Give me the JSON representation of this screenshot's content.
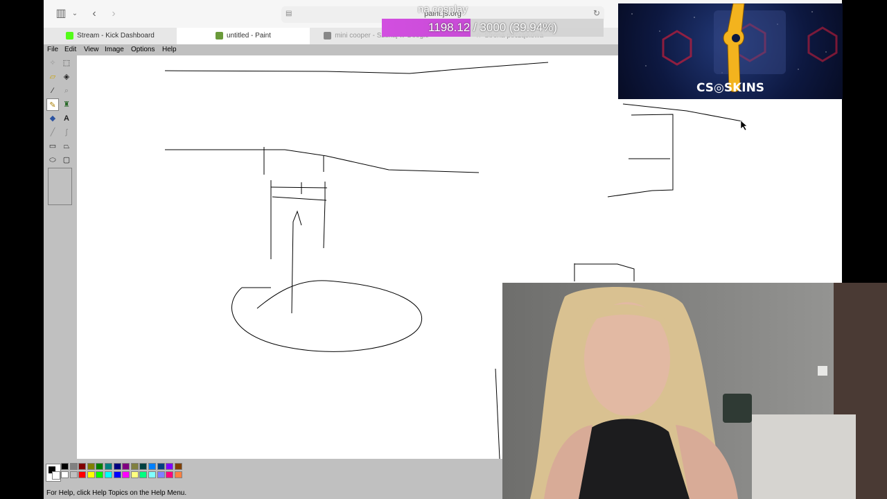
{
  "browser": {
    "url": "paint.js.org",
    "tabs": [
      {
        "label": "Stream - Kick Dashboard",
        "favicon_color": "#53fc18"
      },
      {
        "label": "untitled - Paint",
        "favicon_color": "#6a9a3a"
      },
      {
        "label": "mini cooper - Szukaj w Google",
        "favicon_color": "#888888"
      },
      {
        "label": "Strona początkowa",
        "favicon_color": "#999999"
      }
    ]
  },
  "paint": {
    "menu": [
      "File",
      "Edit",
      "View",
      "Image",
      "Options",
      "Help"
    ],
    "status": "For Help, click Help Topics on the Help Menu.",
    "tools": [
      "free-select",
      "select",
      "eraser",
      "fill",
      "pick-color",
      "magnifier",
      "pencil",
      "brush",
      "airbrush",
      "text",
      "line",
      "curve",
      "rectangle",
      "polygon",
      "ellipse",
      "rounded-rectangle"
    ],
    "palette_top": [
      "#000000",
      "#808080",
      "#800000",
      "#808000",
      "#008000",
      "#008080",
      "#000080",
      "#800080",
      "#808040",
      "#004040",
      "#0080ff",
      "#004080",
      "#8000ff",
      "#804000"
    ],
    "palette_bottom": [
      "#ffffff",
      "#c0c0c0",
      "#ff0000",
      "#ffff00",
      "#00ff00",
      "#00ffff",
      "#0000ff",
      "#ff00ff",
      "#ffff80",
      "#00ff80",
      "#80ffff",
      "#8080ff",
      "#ff0080",
      "#ff8040"
    ]
  },
  "overlay": {
    "goal_title": "na cosplay",
    "goal_current": "1198.12",
    "goal_target": "3000",
    "goal_percent_text": "(39.94%)",
    "goal_progress": 0.3994,
    "goal_text": "1198.12 / 3000 (39.94%)",
    "ad_brand": "CS⁠◎SKINS"
  }
}
